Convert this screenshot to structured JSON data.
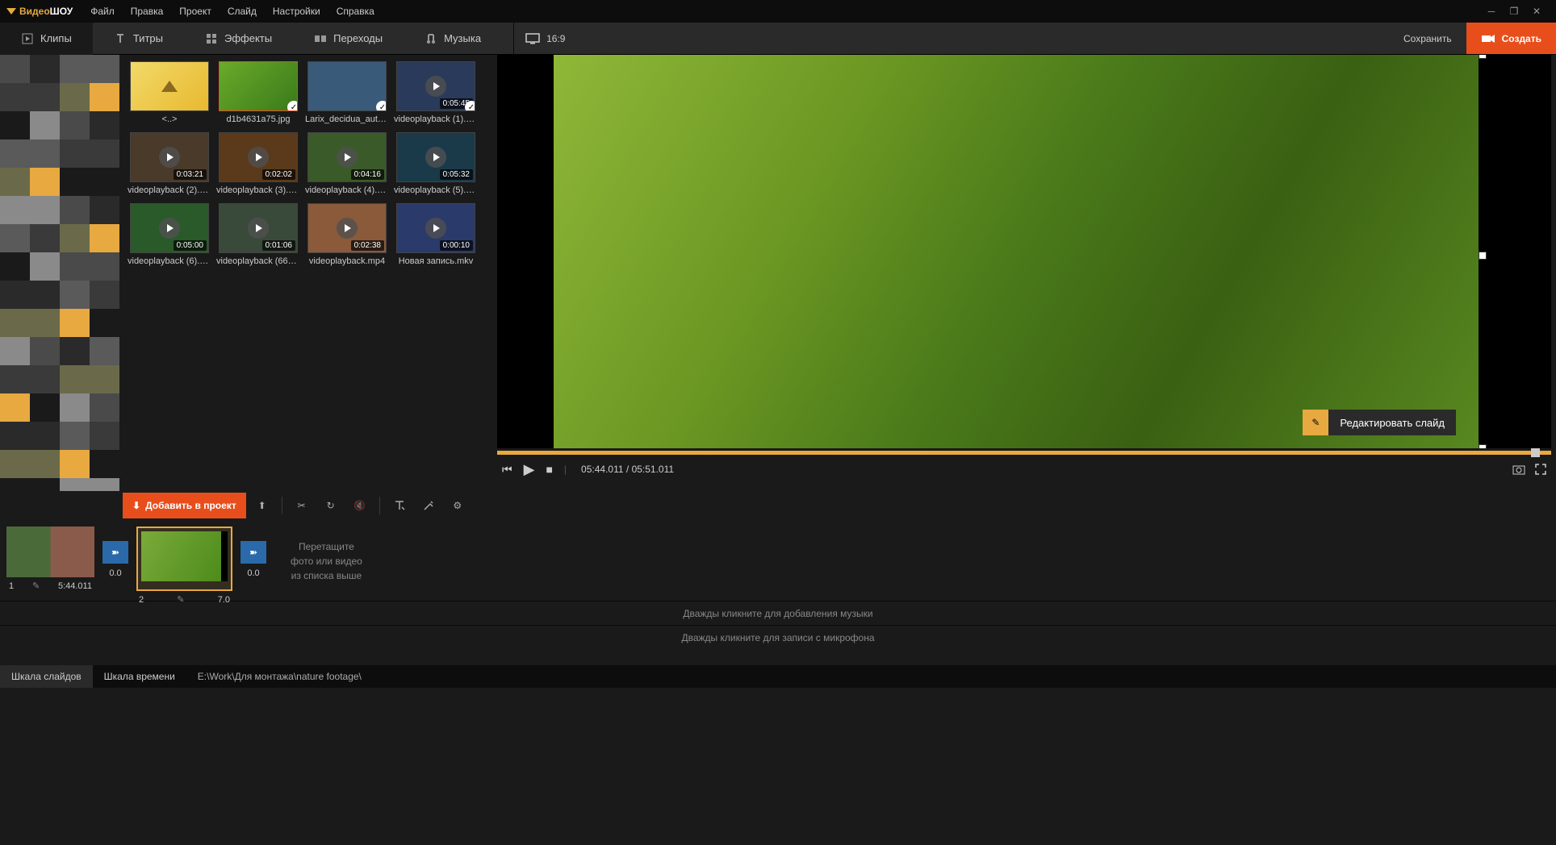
{
  "app": {
    "name1": "Видео",
    "name2": "ШОУ"
  },
  "menu": [
    "Файл",
    "Правка",
    "Проект",
    "Слайд",
    "Настройки",
    "Справка"
  ],
  "tabs": [
    {
      "label": "Клипы",
      "active": true
    },
    {
      "label": "Титры"
    },
    {
      "label": "Эффекты"
    },
    {
      "label": "Переходы"
    },
    {
      "label": "Музыка"
    }
  ],
  "aspectRatio": "16:9",
  "topRight": {
    "save": "Сохранить",
    "create": "Создать"
  },
  "clips": [
    {
      "name": "<..>",
      "folder": true
    },
    {
      "name": "d1b4631a75.jpg",
      "selected": true,
      "checked": true,
      "bg": "linear-gradient(135deg,#6aaa2a,#3a7a1a)"
    },
    {
      "name": "Larix_decidua_autumn...",
      "checked": true,
      "bg": "#3a5a7a"
    },
    {
      "name": "videoplayback (1).mp4",
      "duration": "0:05:45",
      "video": true,
      "checked": true,
      "bg": "#2a3a5a"
    },
    {
      "name": "videoplayback (2).mp4",
      "duration": "0:03:21",
      "video": true,
      "bg": "#4a3a2a"
    },
    {
      "name": "videoplayback (3).mp4",
      "duration": "0:02:02",
      "video": true,
      "bg": "#5a3a1a"
    },
    {
      "name": "videoplayback (4).mp4",
      "duration": "0:04:16",
      "video": true,
      "bg": "#3a5a2a"
    },
    {
      "name": "videoplayback (5).mp4",
      "duration": "0:05:32",
      "video": true,
      "bg": "#1a3a4a"
    },
    {
      "name": "videoplayback (6).mp4",
      "duration": "0:05:00",
      "video": true,
      "bg": "#2a5a2a"
    },
    {
      "name": "videoplayback (666).mp4",
      "duration": "0:01:06",
      "video": true,
      "bg": "#3a4a3a"
    },
    {
      "name": "videoplayback.mp4",
      "duration": "0:02:38",
      "video": true,
      "bg": "#8a5a3a"
    },
    {
      "name": "Новая запись.mkv",
      "duration": "0:00:10",
      "video": true,
      "bg": "#2a3a6a"
    }
  ],
  "editSlideBtn": "Редактировать слайд",
  "addProjectBtn": "Добавить в проект",
  "playerTime": {
    "current": "05:44.011",
    "total": "05:51.011"
  },
  "timeline": {
    "slides": [
      {
        "index": "1",
        "duration": "5:44.011",
        "bg": "linear-gradient(90deg,#4a6a3a 50%,#8a5a4a 50%)"
      },
      {
        "index": "2",
        "duration": "7.0",
        "selected": true,
        "bg": "linear-gradient(120deg,#7aaa3a,#4a8a1a)"
      }
    ],
    "transitions": [
      "0.0",
      "0.0"
    ],
    "dropHint": [
      "Перетащите",
      "фото или видео",
      "из списка выше"
    ]
  },
  "audioHint": "Дважды кликните для добавления музыки",
  "micHint": "Дважды кликните для записи с микрофона",
  "bottomTabs": {
    "slides": "Шкала слайдов",
    "time": "Шкала времени"
  },
  "filePath": "E:\\Work\\Для монтажа\\nature footage\\"
}
